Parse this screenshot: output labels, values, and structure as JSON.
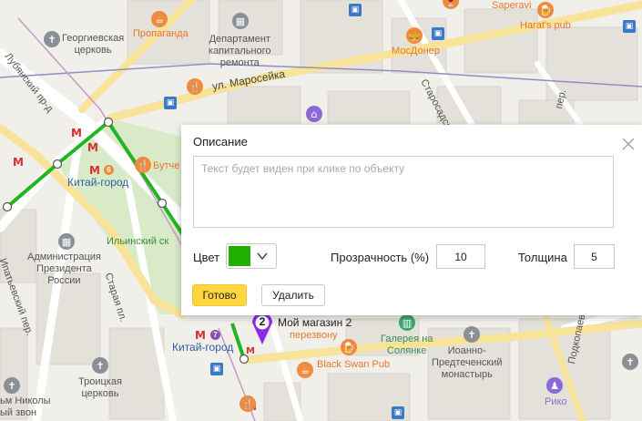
{
  "map": {
    "street_labels": {
      "lubyansky": "Лубянский пр-д",
      "maroseyka": "ул. Маросейка",
      "starosadsky": "Старосадский",
      "ipatyevsky": "Ипатьевский пер.",
      "staraya": "Старая пл.",
      "podkopaevsky": "Подкопаевский",
      "kolpachny": "пер."
    },
    "pois": {
      "georgievskaya": "Георгиевская\nцерковь",
      "propaganda": "Пропаганда",
      "department": "Департамент\nкапитального\nремонта",
      "saperavi": "Saperavi",
      "harats": "Harat's pub",
      "mosdoner": "МосДонер",
      "butcher": "Бутче",
      "ilyinsky": "Ильинский ск",
      "administration": "Администрация\nПрезидента\nРоссии",
      "kitay_gorod_north": "Китай-город",
      "kitay_gorod_south": "Китай-город",
      "gallery": "Галерея на\nСолянке",
      "black_swan": "Black Swan Pub",
      "ioanno": "Иоанно-\nПредтеченский\nмонастырь",
      "riko": "Рико",
      "troitskaya": "Троицкая\nцерковь",
      "nikoly": "ьм Николы\nый звон",
      "peresvonu": "перезвону"
    },
    "metro_line_number": "6",
    "metro_line_7": "7",
    "colors": {
      "route": "#22b522",
      "metro": "#d62f2f",
      "marker": "#8a2be2"
    }
  },
  "dialog": {
    "title": "Описание",
    "description_placeholder": "Текст будет виден при клике по объекту",
    "description_value": "",
    "color_label": "Цвет",
    "color_value": "#22b000",
    "opacity_label": "Прозрачность (%)",
    "opacity_value": "10",
    "thickness_label": "Толщина",
    "thickness_value": "5",
    "done_label": "Готово",
    "delete_label": "Удалить"
  },
  "marker": {
    "number": "2",
    "label": "Мой магазин 2"
  }
}
